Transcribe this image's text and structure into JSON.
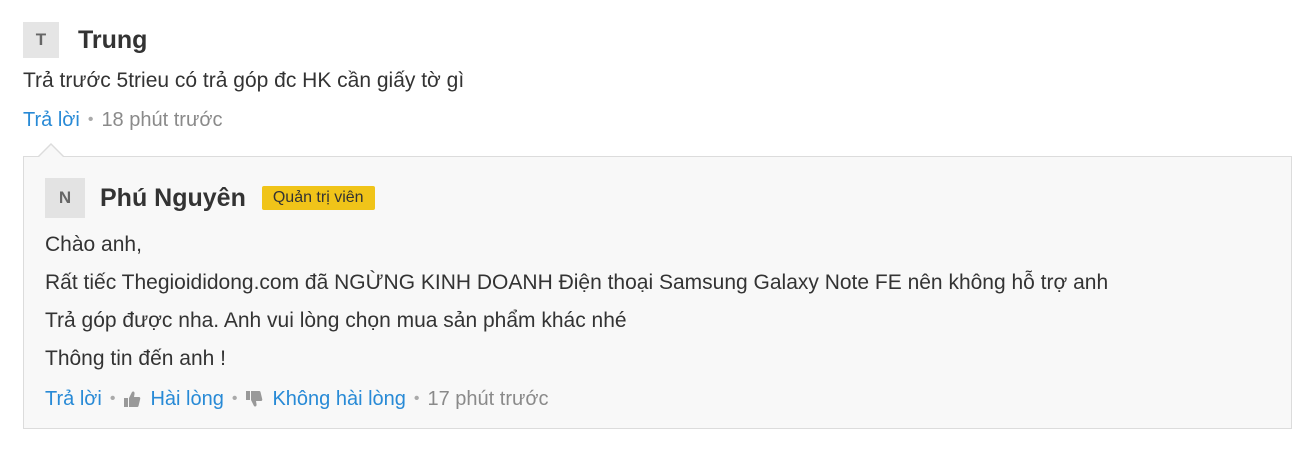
{
  "comment": {
    "avatar_letter": "T",
    "author": "Trung",
    "body": "Trả trước 5trieu có trả góp đc HK cần giấy tờ gì",
    "reply_label": "Trả lời",
    "separator": "•",
    "time": "18 phút trước"
  },
  "reply": {
    "avatar_letter": "N",
    "author": "Phú Nguyên",
    "badge": "Quản trị viên",
    "lines": [
      "Chào anh,",
      "Rất tiếc Thegioididong.com đã NGỪNG KINH DOANH Điện thoại Samsung Galaxy Note FE nên không hỗ trợ anh",
      "Trả góp được nha. Anh vui lòng chọn mua sản phẩm khác nhé",
      "Thông tin đến anh !"
    ],
    "reply_label": "Trả lời",
    "like_label": "Hài lòng",
    "dislike_label": "Không hài lòng",
    "separator": "•",
    "time": "17 phút trước"
  },
  "icons": {
    "like": "thumbs-up-icon",
    "dislike": "thumbs-down-icon"
  },
  "colors": {
    "link": "#288ad6",
    "badge": "#f0c419",
    "reply_bg": "#f8f8f8",
    "border": "#dcdcdc"
  }
}
